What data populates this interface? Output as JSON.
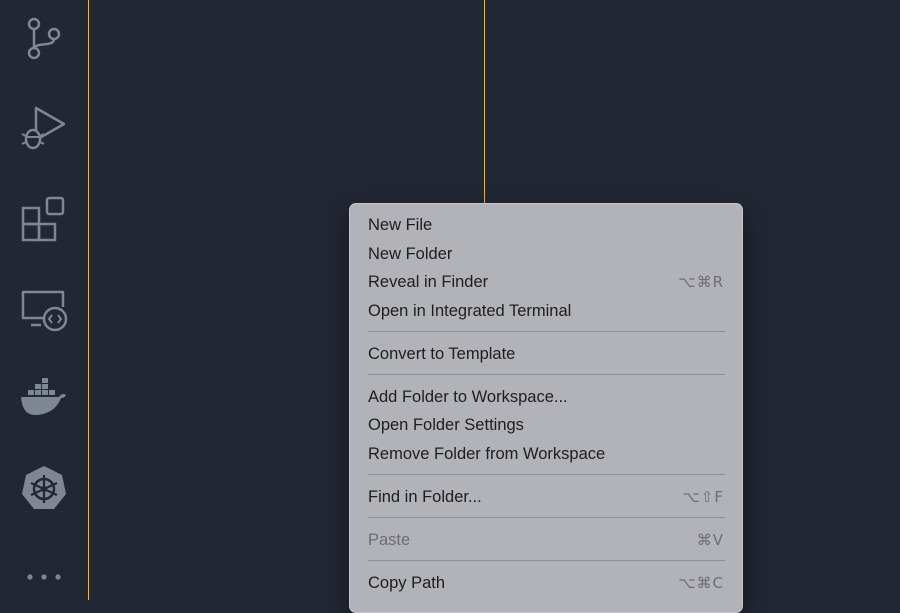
{
  "activity_bar": {
    "icons": [
      "source-control-icon",
      "run-and-debug-icon",
      "extensions-icon",
      "remote-explorer-icon",
      "docker-icon",
      "kubernetes-icon",
      "more-icon"
    ]
  },
  "context_menu": {
    "items": [
      {
        "label": "New File",
        "shortcut": ""
      },
      {
        "label": "New Folder",
        "shortcut": ""
      },
      {
        "label": "Reveal in Finder",
        "shortcut": "⌥⌘R"
      },
      {
        "label": "Open in Integrated Terminal",
        "shortcut": ""
      },
      {
        "label": "Convert to Template",
        "shortcut": ""
      },
      {
        "label": "Add Folder to Workspace...",
        "shortcut": ""
      },
      {
        "label": "Open Folder Settings",
        "shortcut": ""
      },
      {
        "label": "Remove Folder from Workspace",
        "shortcut": ""
      },
      {
        "label": "Find in Folder...",
        "shortcut": "⌥⇧F"
      },
      {
        "label": "Paste",
        "shortcut": "⌘V",
        "disabled": true
      },
      {
        "label": "Copy Path",
        "shortcut": "⌥⌘C"
      }
    ]
  },
  "colors": {
    "background": "#222734",
    "accent_border": "#e5b84f",
    "icon": "#7f8694",
    "menu_bg": "#b2b2b9"
  }
}
